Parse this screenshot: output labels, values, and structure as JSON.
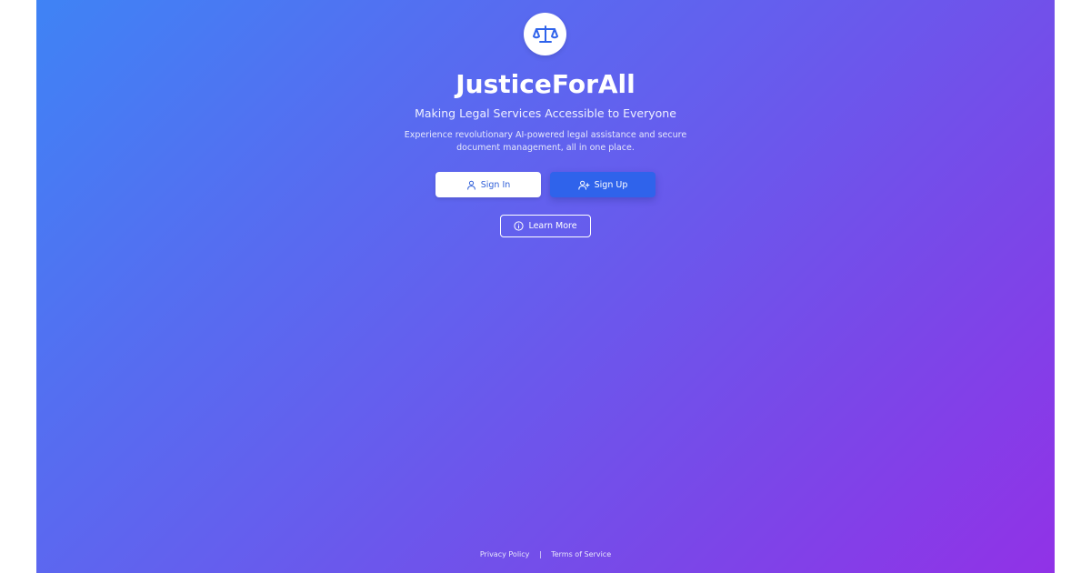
{
  "hero": {
    "logo_icon": "scale-icon",
    "title": "JusticeForAll",
    "subtitle": "Making Legal Services Accessible to Everyone",
    "description": "Experience revolutionary AI-powered legal assistance and secure document management, all in one place."
  },
  "actions": {
    "sign_in": {
      "label": "Sign In",
      "icon": "user-icon"
    },
    "sign_up": {
      "label": "Sign Up",
      "icon": "user-plus-icon"
    },
    "learn_more": {
      "label": "Learn More",
      "icon": "info-icon"
    }
  },
  "footer": {
    "privacy": "Privacy Policy",
    "separator": "|",
    "terms": "Terms of Service"
  },
  "colors": {
    "gradient_start": "#3f83f5",
    "gradient_end": "#9132e7",
    "primary_button": "#2f63eb",
    "logo_icon": "#2f63eb"
  }
}
